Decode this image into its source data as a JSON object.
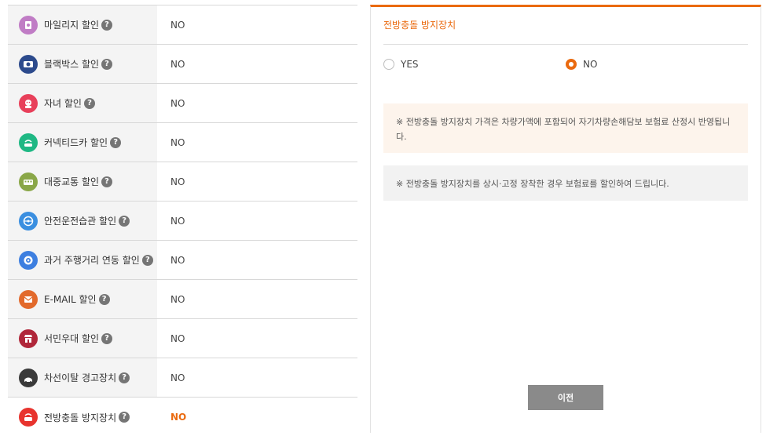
{
  "rows": [
    {
      "label": "마일리지 할인",
      "value": "NO",
      "icon": "mileage-icon",
      "icon_color": "#c07cc5",
      "active": false
    },
    {
      "label": "블랙박스 할인",
      "value": "NO",
      "icon": "blackbox-icon",
      "icon_color": "#2c4a8c",
      "active": false
    },
    {
      "label": "자녀 할인",
      "value": "NO",
      "icon": "child-icon",
      "icon_color": "#e8405a",
      "active": false
    },
    {
      "label": "커넥티드카 할인",
      "value": "NO",
      "icon": "connected-car-icon",
      "icon_color": "#1fb884",
      "active": false
    },
    {
      "label": "대중교통 할인",
      "value": "NO",
      "icon": "bus-icon",
      "icon_color": "#8aa748",
      "active": false
    },
    {
      "label": "안전운전습관 할인",
      "value": "NO",
      "icon": "steering-wheel-icon",
      "icon_color": "#3b8fe0",
      "active": false
    },
    {
      "label": "과거 주행거리 연동 할인",
      "value": "NO",
      "icon": "odometer-icon",
      "icon_color": "#3d7fe0",
      "active": false
    },
    {
      "label": "E-MAIL 할인",
      "value": "NO",
      "icon": "email-icon",
      "icon_color": "#e26a2c",
      "active": false
    },
    {
      "label": "서민우대 할인",
      "value": "NO",
      "icon": "shop-icon",
      "icon_color": "#b0273a",
      "active": false
    },
    {
      "label": "차선이탈 경고장치",
      "value": "NO",
      "icon": "lane-warning-icon",
      "icon_color": "#3a3a3a",
      "active": false
    },
    {
      "label": "전방충돌 방지장치",
      "value": "NO",
      "icon": "collision-warning-icon",
      "icon_color": "#e8342e",
      "active": true
    }
  ],
  "panel": {
    "title": "전방충돌 방지장치",
    "options": [
      {
        "label": "YES",
        "checked": false
      },
      {
        "label": "NO",
        "checked": true
      }
    ],
    "notice1": "※ 전방충돌 방지장치 가격은 차량가액에 포함되어 자기차량손해담보 보험료 산정시 반영됩니다.",
    "notice2": "※ 전방충돌 방지장치를 상시·고정 장착한 경우 보험료를 할인하여 드립니다.",
    "prev_label": "이전",
    "help_glyph": "?"
  },
  "accent_color": "#ea6a0f"
}
